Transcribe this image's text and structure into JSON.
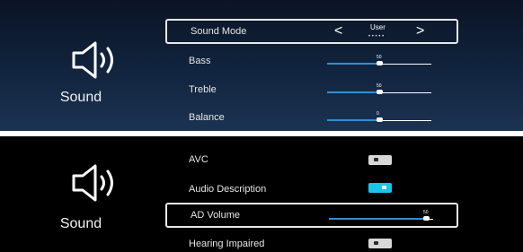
{
  "panel_top": {
    "icon": "speaker-volume-icon",
    "label": "Sound",
    "items": [
      {
        "label": "Sound Mode",
        "value": "User",
        "prev_glyph": "<",
        "next_glyph": ">",
        "dots": "• • • • •"
      },
      {
        "label": "Bass",
        "value": "50",
        "fraction": 0.5
      },
      {
        "label": "Treble",
        "value": "50",
        "fraction": 0.5
      },
      {
        "label": "Balance",
        "value": "0",
        "fraction": 0.5
      }
    ]
  },
  "panel_bottom": {
    "icon": "speaker-volume-icon",
    "label": "Sound",
    "items": [
      {
        "label": "AVC",
        "state": "off"
      },
      {
        "label": "Audio Description",
        "state": "on"
      },
      {
        "label": "AD Volume",
        "value": "50",
        "fraction": 0.93
      },
      {
        "label": "Hearing Impaired",
        "state": "off"
      }
    ]
  },
  "colors": {
    "accent": "#2f8fd6",
    "toggle_on": "#19c6ea",
    "toggle_off": "#d8d8d8"
  }
}
